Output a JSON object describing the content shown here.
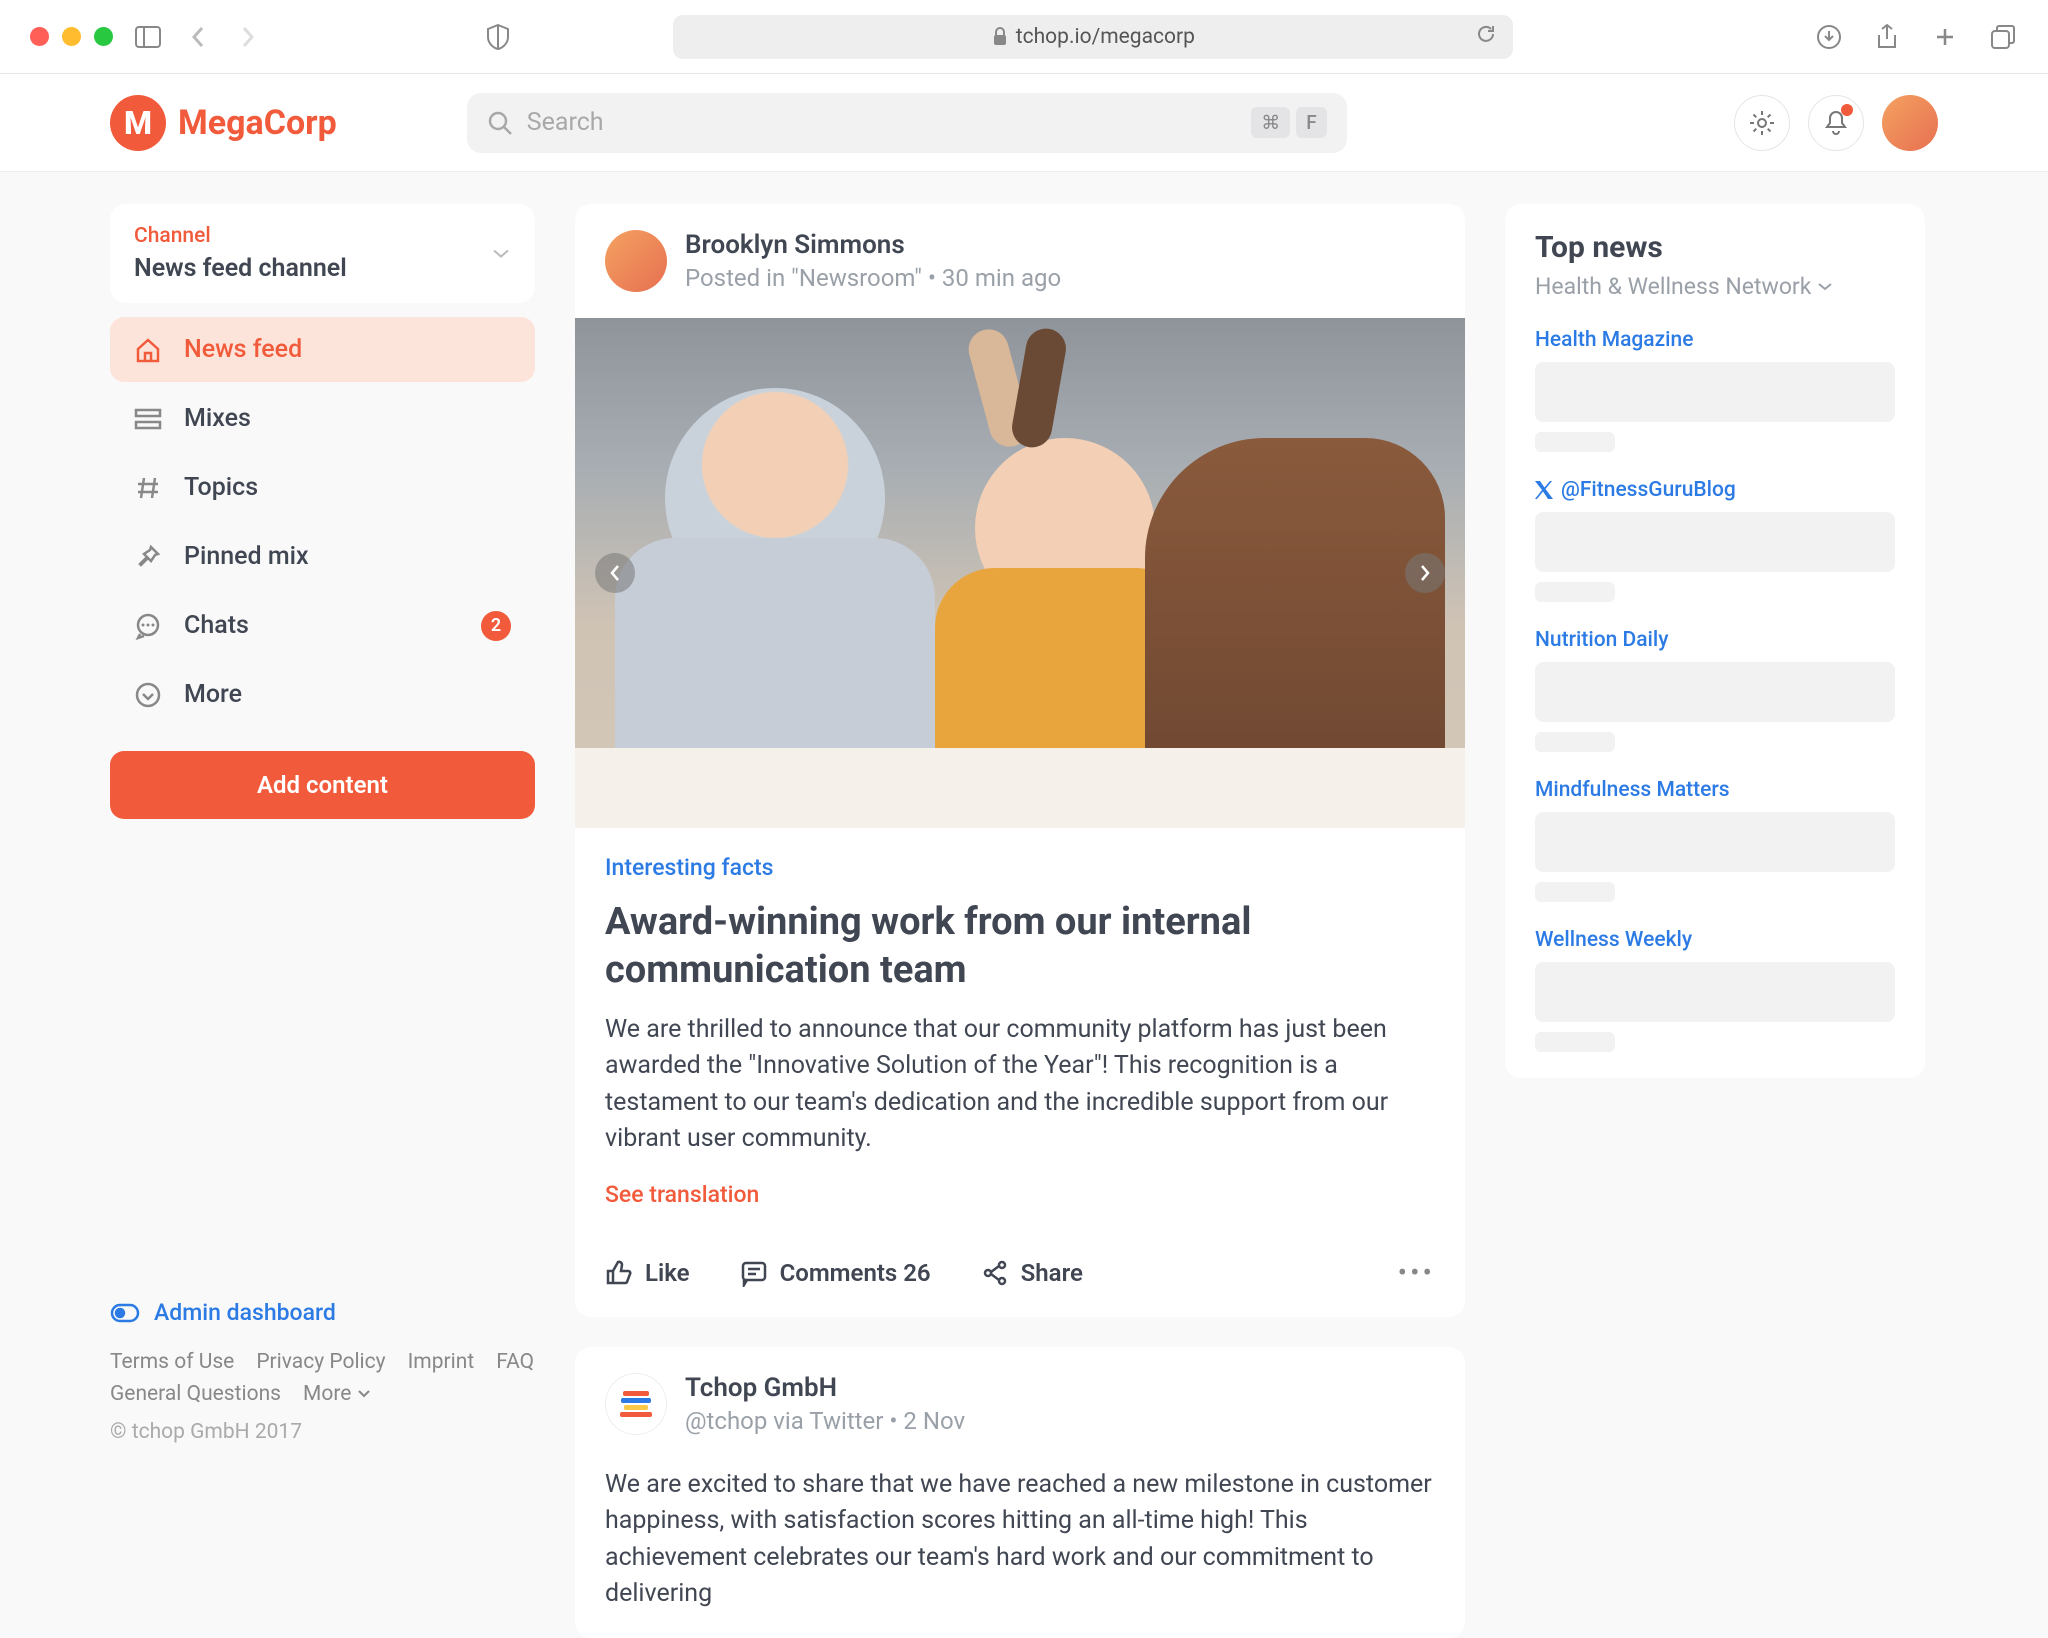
{
  "browser": {
    "url": "tchop.io/megacorp"
  },
  "app": {
    "name": "MegaCorp",
    "search_placeholder": "Search",
    "kbd1": "⌘",
    "kbd2": "F"
  },
  "sidebar": {
    "channel_label": "Channel",
    "channel_name": "News feed channel",
    "items": [
      {
        "label": "News feed"
      },
      {
        "label": "Mixes"
      },
      {
        "label": "Topics"
      },
      {
        "label": "Pinned mix"
      },
      {
        "label": "Chats",
        "badge": "2"
      },
      {
        "label": "More"
      }
    ],
    "add_button": "Add content",
    "admin_link": "Admin dashboard",
    "footer": {
      "terms": "Terms of Use",
      "privacy": "Privacy Policy",
      "imprint": "Imprint",
      "faq": "FAQ",
      "general": "General Questions",
      "more": "More",
      "copyright": "© tchop GmbH 2017"
    }
  },
  "feed": {
    "post1": {
      "author": "Brooklyn Simmons",
      "meta": "Posted in \"Newsroom\" • 30 min ago",
      "tag": "Interesting facts",
      "title": "Award-winning work from our internal communication team",
      "body": "We are thrilled to announce that our community platform has just been awarded the \"Innovative Solution of the Year\"! This recognition is a testament to our team's dedication and the incredible support from our vibrant user community.",
      "translate": "See translation",
      "like": "Like",
      "comments": "Comments 26",
      "share": "Share"
    },
    "post2": {
      "author": "Tchop GmbH",
      "meta": "@tchop via Twitter • 2 Nov",
      "body": "We are excited to share that we have reached a new milestone in customer happiness, with satisfaction scores hitting an all-time high! This achievement celebrates our team's hard work and our commitment to delivering"
    }
  },
  "news": {
    "title": "Top news",
    "subtitle": "Health & Wellness Network",
    "items": [
      {
        "source": "Health Magazine"
      },
      {
        "source": "@FitnessGuruBlog",
        "x": true
      },
      {
        "source": "Nutrition Daily"
      },
      {
        "source": "Mindfulness Matters"
      },
      {
        "source": "Wellness Weekly"
      }
    ]
  }
}
